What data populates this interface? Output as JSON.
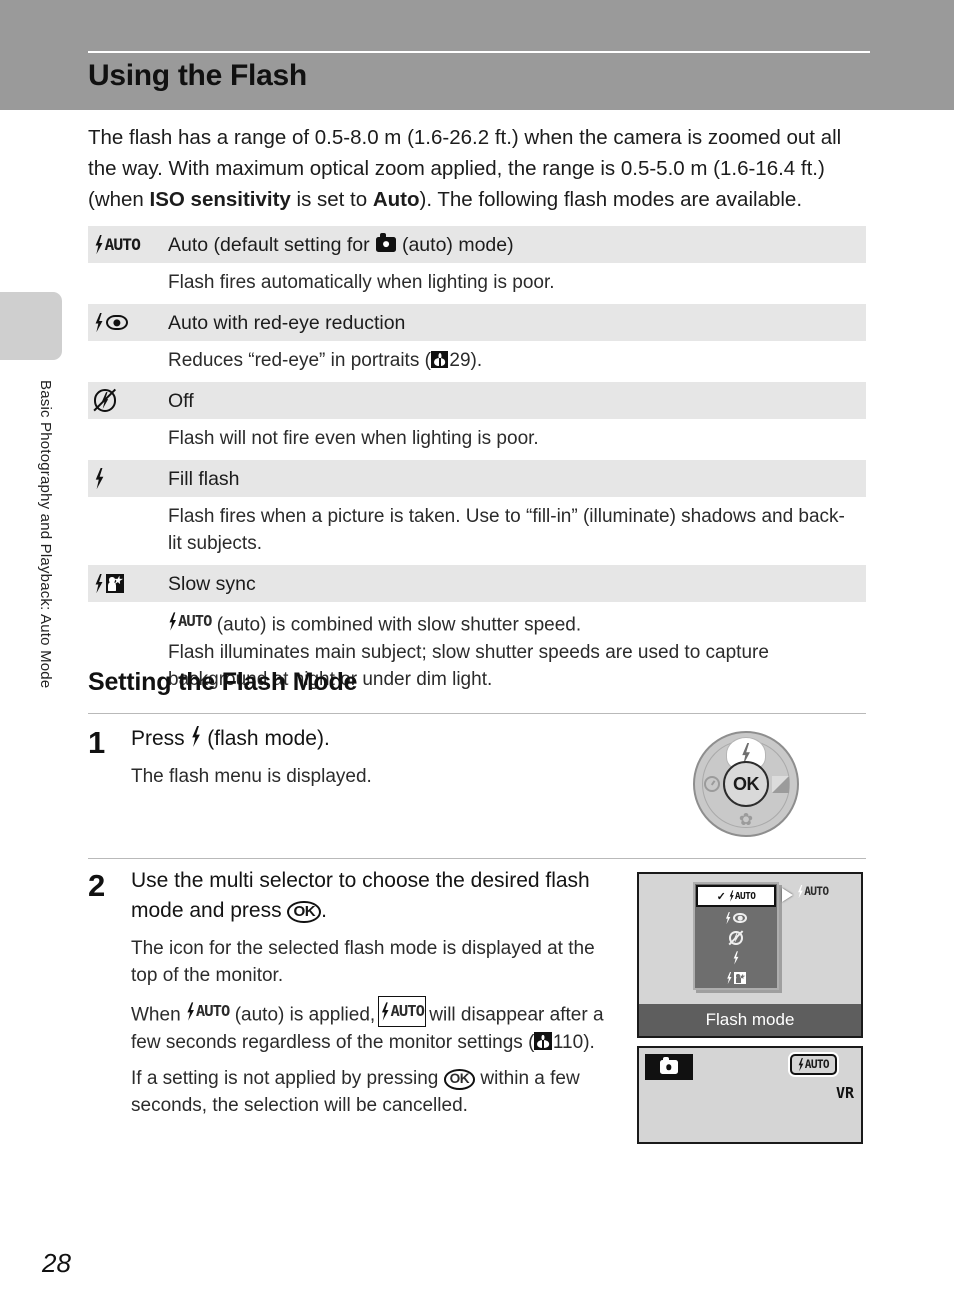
{
  "header": {
    "title": "Using the Flash"
  },
  "sidebar": {
    "chapter_label": "Basic Photography and Playback: Auto Mode"
  },
  "intro": {
    "part1": "The flash has a range of 0.5-8.0 m (1.6-26.2 ft.) when the camera is zoomed out all the way. With maximum optical zoom applied, the range is 0.5-5.0 m (1.6-16.4 ft.) (when ",
    "bold1": "ISO sensitivity",
    "part2": " is set to ",
    "bold2": "Auto",
    "part3": "). The following flash modes are available."
  },
  "flash_modes": [
    {
      "icon": "flash-auto-icon",
      "name_before": "Auto (default setting for ",
      "name_after": " (auto) mode)",
      "description": "Flash fires automatically when lighting is poor."
    },
    {
      "icon": "flash-redeye-icon",
      "name": "Auto with red-eye reduction",
      "desc_before": "Reduces “red-eye” in portraits (",
      "desc_page": "29",
      "desc_after": ")."
    },
    {
      "icon": "flash-off-icon",
      "name": "Off",
      "description": "Flash will not fire even when lighting is poor."
    },
    {
      "icon": "fill-flash-icon",
      "name": "Fill flash",
      "description": "Flash fires when a picture is taken. Use to “fill-in” (illuminate) shadows and back-lit subjects."
    },
    {
      "icon": "slow-sync-icon",
      "name": "Slow sync",
      "desc_line1_after": " (auto) is combined with slow shutter speed.",
      "desc_line2": "Flash illuminates main subject; slow shutter speeds are used to capture background at night or under dim light."
    }
  ],
  "section": {
    "heading": "Setting the Flash Mode"
  },
  "steps": [
    {
      "number": "1",
      "title_before": "Press ",
      "title_after": " (flash mode).",
      "note": "The flash menu is displayed."
    },
    {
      "number": "2",
      "title_before": "Use the multi selector to choose the desired flash mode and press ",
      "ok_label": "OK",
      "title_after": ".",
      "note1": "The icon for the selected flash mode is displayed at the top of the monitor.",
      "note2_a": "When ",
      "note2_b": " (auto) is applied, ",
      "note2_c": " will disappear after a few seconds regardless of the monitor settings (",
      "note2_page": "110",
      "note2_d": ").",
      "note3_a": "If a setting is not applied by pressing ",
      "note3_b": " within a few seconds, the selection will be cancelled."
    }
  ],
  "dial": {
    "ok_label": "OK",
    "top_icon": "flash-icon",
    "left_icon": "self-timer-icon",
    "right_icon": "exposure-compensation-icon",
    "bottom_icon": "macro-flower-icon"
  },
  "monitor_menu": {
    "items": [
      {
        "icon": "flash-auto-icon",
        "label": "AUTO",
        "selected": true
      },
      {
        "icon": "flash-redeye-icon",
        "selected": false
      },
      {
        "icon": "flash-off-icon",
        "selected": false
      },
      {
        "icon": "fill-flash-icon",
        "selected": false
      },
      {
        "icon": "slow-sync-icon",
        "selected": false
      }
    ],
    "callout_label": "AUTO",
    "caption": "Flash mode"
  },
  "monitor_live": {
    "mode_icon": "camera-auto-mode-icon",
    "flash_badge": "AUTO",
    "vr_label": "VR"
  },
  "footer": {
    "page_number": "28"
  },
  "colors": {
    "header_band": "#9a9a9a",
    "table_row_header": "#e6e6e6",
    "monitor_background": "#d5d5d5",
    "monitor_caption_bar": "#5e5e5e",
    "menu_popup": "#6e6e6e"
  }
}
